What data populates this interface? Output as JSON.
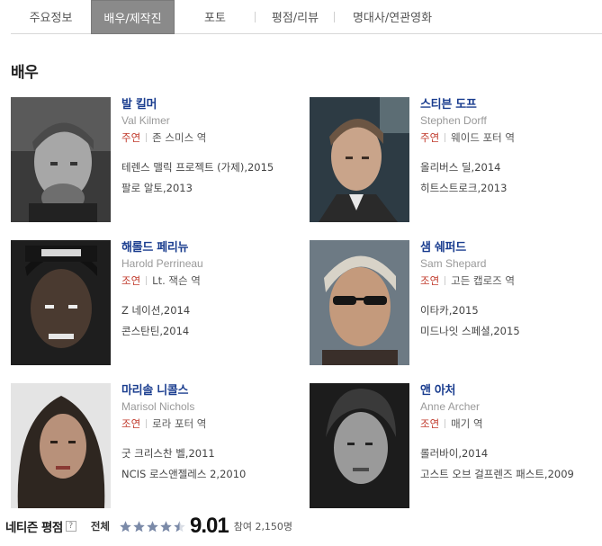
{
  "tabs": [
    {
      "label": "주요정보",
      "active": false
    },
    {
      "label": "배우/제작진",
      "active": true
    },
    {
      "label": "포토",
      "active": false
    },
    {
      "label": "평점/리뷰",
      "active": false
    },
    {
      "label": "명대사/연관영화",
      "active": false
    }
  ],
  "section_title": "배우",
  "actors": [
    {
      "name": "발 킬머",
      "eng": "Val Kilmer",
      "role_type": "주연",
      "role": "존 스미스 역",
      "works": [
        "테렌스 맬릭 프로젝트 (가제),2015",
        "팔로 알토,2013"
      ]
    },
    {
      "name": "스티븐 도프",
      "eng": "Stephen Dorff",
      "role_type": "주연",
      "role": "웨이드 포터 역",
      "works": [
        "올리버스 딜,2014",
        "히트스트로크,2013"
      ]
    },
    {
      "name": "해롤드 페리뉴",
      "eng": "Harold Perrineau",
      "role_type": "조연",
      "role": "Lt. 잭슨 역",
      "works": [
        "Z 네이션,2014",
        "콘스탄틴,2014"
      ]
    },
    {
      "name": "샘 쉐퍼드",
      "eng": "Sam Shepard",
      "role_type": "조연",
      "role": "고든 캡로즈 역",
      "works": [
        "이타카,2015",
        "미드나잇 스페셜,2015"
      ]
    },
    {
      "name": "마리솔 니콜스",
      "eng": "Marisol Nichols",
      "role_type": "조연",
      "role": "로라 포터 역",
      "works": [
        "굿 크리스찬 벨,2011",
        "NCIS 로스앤젤레스 2,2010"
      ]
    },
    {
      "name": "앤 아처",
      "eng": "Anne Archer",
      "role_type": "조연",
      "role": "매기 역",
      "works": [
        "롤러바이,2014",
        "고스트 오브 걸프렌즈 패스트,2009"
      ]
    }
  ],
  "rating": {
    "title": "네티즌 평점",
    "help": "?",
    "scope": "전체",
    "score": "9.01",
    "count": "참여 2,150명",
    "stars": 4.5,
    "star_color": "#7b8aa8"
  },
  "colors": {
    "accent_link": "#1a3d8f",
    "role_red": "#c0392b",
    "active_tab": "#8a8a8a"
  }
}
